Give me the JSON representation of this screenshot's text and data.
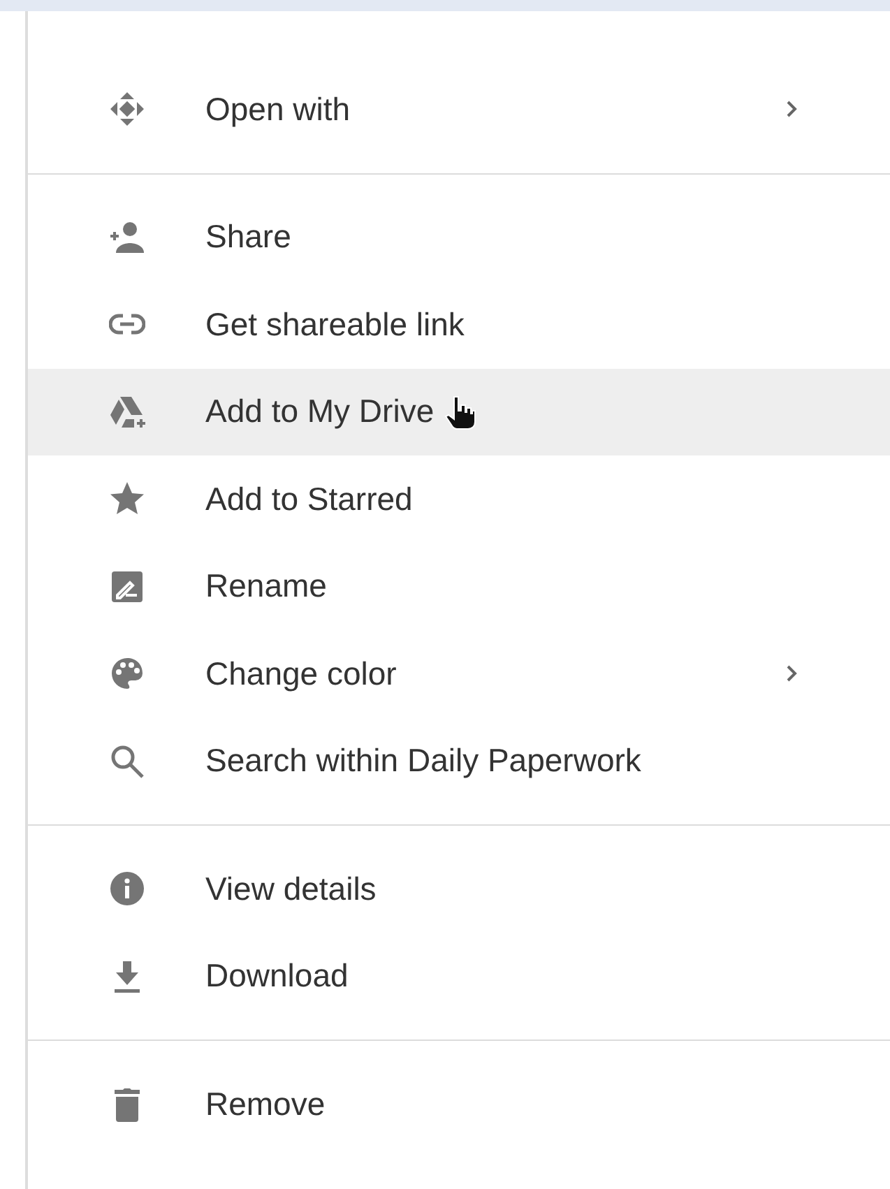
{
  "menu": {
    "groups": [
      {
        "items": [
          {
            "label": "Open with",
            "submenu": true,
            "selected": false
          }
        ]
      },
      {
        "items": [
          {
            "label": "Share",
            "submenu": false,
            "selected": false
          },
          {
            "label": "Get shareable link",
            "submenu": false,
            "selected": false
          },
          {
            "label": "Add to My Drive",
            "submenu": false,
            "selected": true
          },
          {
            "label": "Add to Starred",
            "submenu": false,
            "selected": false
          },
          {
            "label": "Rename",
            "submenu": false,
            "selected": false
          },
          {
            "label": "Change color",
            "submenu": true,
            "selected": false
          },
          {
            "label": "Search within Daily Paperwork",
            "submenu": false,
            "selected": false
          }
        ]
      },
      {
        "items": [
          {
            "label": "View details",
            "submenu": false,
            "selected": false
          },
          {
            "label": "Download",
            "submenu": false,
            "selected": false
          }
        ]
      },
      {
        "items": [
          {
            "label": "Remove",
            "submenu": false,
            "selected": false
          }
        ]
      }
    ]
  }
}
